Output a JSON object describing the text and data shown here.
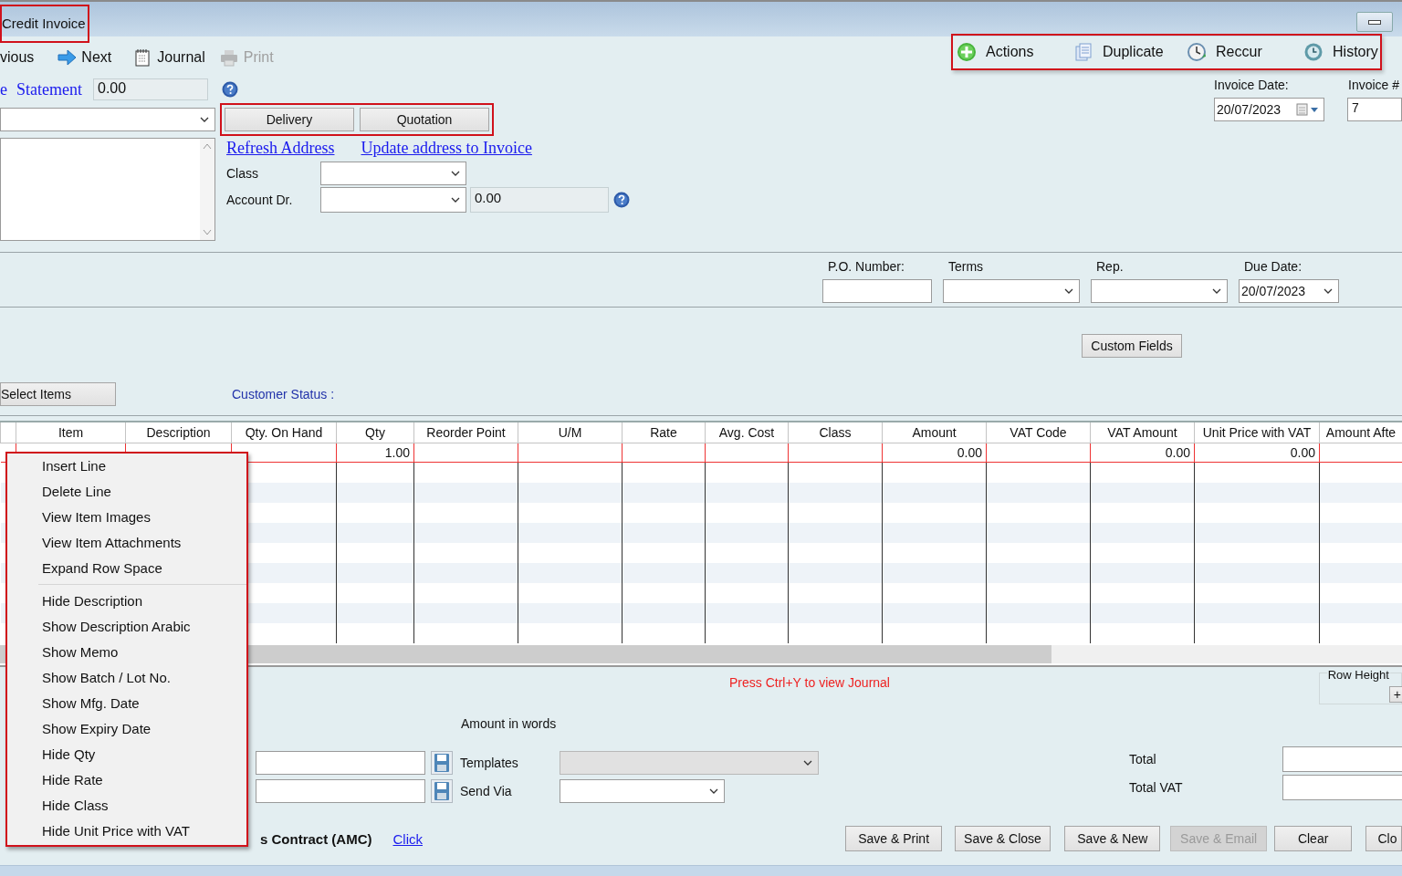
{
  "window": {
    "title": "Credit Invoice",
    "highlighted": true
  },
  "toolbar": [
    {
      "label": "vious",
      "kind": "previous",
      "disabled": false
    },
    {
      "label": "Next",
      "kind": "next",
      "disabled": false
    },
    {
      "label": "Journal",
      "kind": "journal",
      "disabled": false
    },
    {
      "label": "Print",
      "kind": "print",
      "disabled": true
    }
  ],
  "action_bar": {
    "highlighted": true,
    "items": [
      {
        "label": "Actions",
        "kind": "actions"
      },
      {
        "label": "Duplicate",
        "kind": "duplicate"
      },
      {
        "label": "Reccur",
        "kind": "reccur"
      },
      {
        "label": "History",
        "kind": "history"
      }
    ]
  },
  "customer": {
    "link": "e",
    "statement_link": "Statement",
    "balance": "0.00"
  },
  "source_buttons": {
    "highlighted": true,
    "items": [
      "Delivery",
      "Quotation"
    ]
  },
  "address_links": [
    "Refresh Address",
    "Update address to Invoice"
  ],
  "class_label": "Class",
  "account_label": "Account Dr.",
  "account_amount": "0.00",
  "invoice_date": {
    "label": "Invoice Date:",
    "value": "20/07/2023"
  },
  "invoice_number": {
    "label": "Invoice #",
    "value": "7"
  },
  "header_fields": [
    {
      "label": "P.O. Number:",
      "kind": "text"
    },
    {
      "label": "Terms",
      "kind": "combo"
    },
    {
      "label": "Rep.",
      "kind": "combo"
    },
    {
      "label": "Due Date:",
      "kind": "combo",
      "value": "20/07/2023"
    }
  ],
  "custom_fields_button": "Custom Fields",
  "select_items_button": "Select Items",
  "customer_status": "Customer Status :",
  "table": {
    "columns": [
      "Item",
      "Description",
      "Qty. On Hand",
      "Qty",
      "Reorder Point",
      "U/M",
      "Rate",
      "Avg. Cost",
      "Class",
      "Amount",
      "VAT Code",
      "VAT Amount",
      "Unit Price with VAT",
      "Amount Afte"
    ],
    "rows": [
      {
        "cells": [
          null,
          null,
          null,
          "1.00",
          null,
          null,
          null,
          null,
          null,
          "0.00",
          null,
          "0.00",
          "0.00",
          null
        ]
      }
    ]
  },
  "journal_hint": "Press Ctrl+Y to view Journal",
  "row_height": {
    "label": "Row Height",
    "button": "+"
  },
  "amount_in_words_label": "Amount in words",
  "templates": {
    "label": "Templates",
    "disabled": true
  },
  "send_via": {
    "label": "Send Via"
  },
  "totals": [
    {
      "label": "Total"
    },
    {
      "label": "Total VAT"
    }
  ],
  "contract": {
    "label": "s Contract (AMC)",
    "link": "Click"
  },
  "buttons": [
    {
      "label": "Save & Print",
      "disabled": false
    },
    {
      "label": "Save & Close",
      "disabled": false
    },
    {
      "label": "Save & New",
      "disabled": false
    },
    {
      "label": "Save & Email",
      "disabled": true
    },
    {
      "label": "Clear",
      "disabled": false
    },
    {
      "label": "Clo",
      "disabled": false
    }
  ],
  "context_menu": {
    "highlighted": true,
    "sections": [
      {
        "items": [
          "Insert Line",
          "Delete Line",
          "View Item Images",
          "View Item Attachments",
          "Expand Row Space"
        ]
      },
      {
        "items": [
          "Hide Description",
          "Show Description Arabic",
          "Show Memo",
          "Show Batch / Lot No.",
          "Show Mfg. Date",
          "Show Expiry Date",
          "Hide Qty",
          "Hide Rate",
          "Hide Class",
          "Hide Unit Price with VAT"
        ]
      }
    ]
  }
}
